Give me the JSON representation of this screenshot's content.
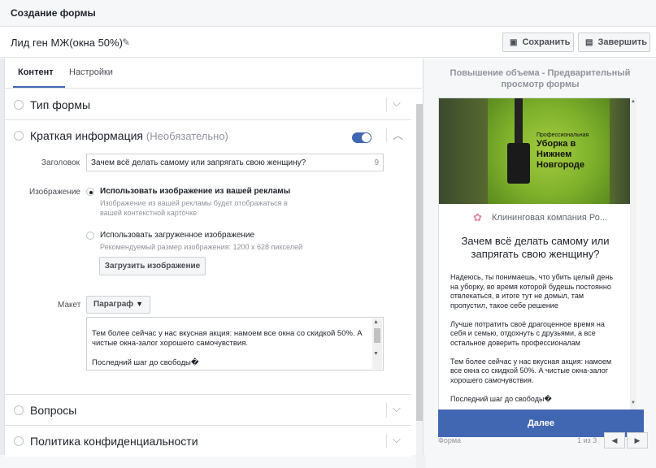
{
  "window": {
    "title": "Создание формы"
  },
  "formbar": {
    "form_name": "Лид ген МЖ(окна 50%)",
    "save_label": "Сохранить",
    "finish_label": "Завершить"
  },
  "tabs": [
    {
      "label": "Контент",
      "active": true
    },
    {
      "label": "Настройки",
      "active": false
    }
  ],
  "sections": {
    "form_type": {
      "title": "Тип формы"
    },
    "intro": {
      "title": "Краткая информация",
      "optional": "(Необязательно)",
      "enabled": true,
      "headline_label": "Заголовок",
      "headline_value": "Зачем всё делать самому или запрягать свою женщину?",
      "headline_count": "9",
      "image_label": "Изображение",
      "image_options": [
        {
          "title": "Использовать изображение из вашей рекламы",
          "desc": "Изображение из вашей рекламы будет отображаться в вашей контекстной карточке",
          "selected": true
        },
        {
          "title": "Использовать загруженное изображение",
          "desc": "Рекомендуемый размер изображения: 1200 x 628 пикселей",
          "selected": false
        }
      ],
      "upload_label": "Загрузить изображение",
      "layout_label": "Макет",
      "layout_value": "Параграф",
      "text_lines": [
        "Тем более сейчас у нас вкусная акция: намоем все окна со скидкой 50%. А",
        "чистые окна-залог хорошего самочувствия.",
        "",
        "Последний шаг до свободы�"
      ]
    },
    "questions": {
      "title": "Вопросы"
    },
    "privacy": {
      "title": "Политика конфиденциальности"
    }
  },
  "preview": {
    "title_line1": "Повышение объема - Предварительный",
    "title_line2": "просмотр формы",
    "hero_small": "Профессиональная",
    "hero_lines": [
      "Уборка в",
      "Нижнем",
      "Новгороде"
    ],
    "brand_name": "Клининговая компания Ро...",
    "headline": "Зачем всё делать самому или запрягать свою женщину?",
    "body_paragraphs": [
      "Надеюсь, ты понимаешь, что убить целый день на уборку, во время которой будешь постоянно отвлекаться, в итоге тут не домыл, там пропустил, такое себе решение",
      "Лучше потратить своё драгоценное время на себя и семью, отдохнуть с друзьями, а все остальное доверить профессионалам",
      "Тем более сейчас у нас вкусная акция: намоем все окна со скидкой 50%. А чистые окна-залог хорошего самочувствия.",
      "Последний шаг до свободы�"
    ],
    "next_label": "Далее",
    "footer_label": "Форма",
    "footer_count": "1 из 3"
  },
  "colors": {
    "accent": "#4267b2",
    "border": "#dddfe2",
    "muted": "#90949c"
  },
  "icons": {
    "edit": "pencil-icon",
    "save": "save-icon",
    "finish": "document-icon",
    "expand": "chevron-down-icon",
    "collapse": "chevron-up-icon"
  }
}
